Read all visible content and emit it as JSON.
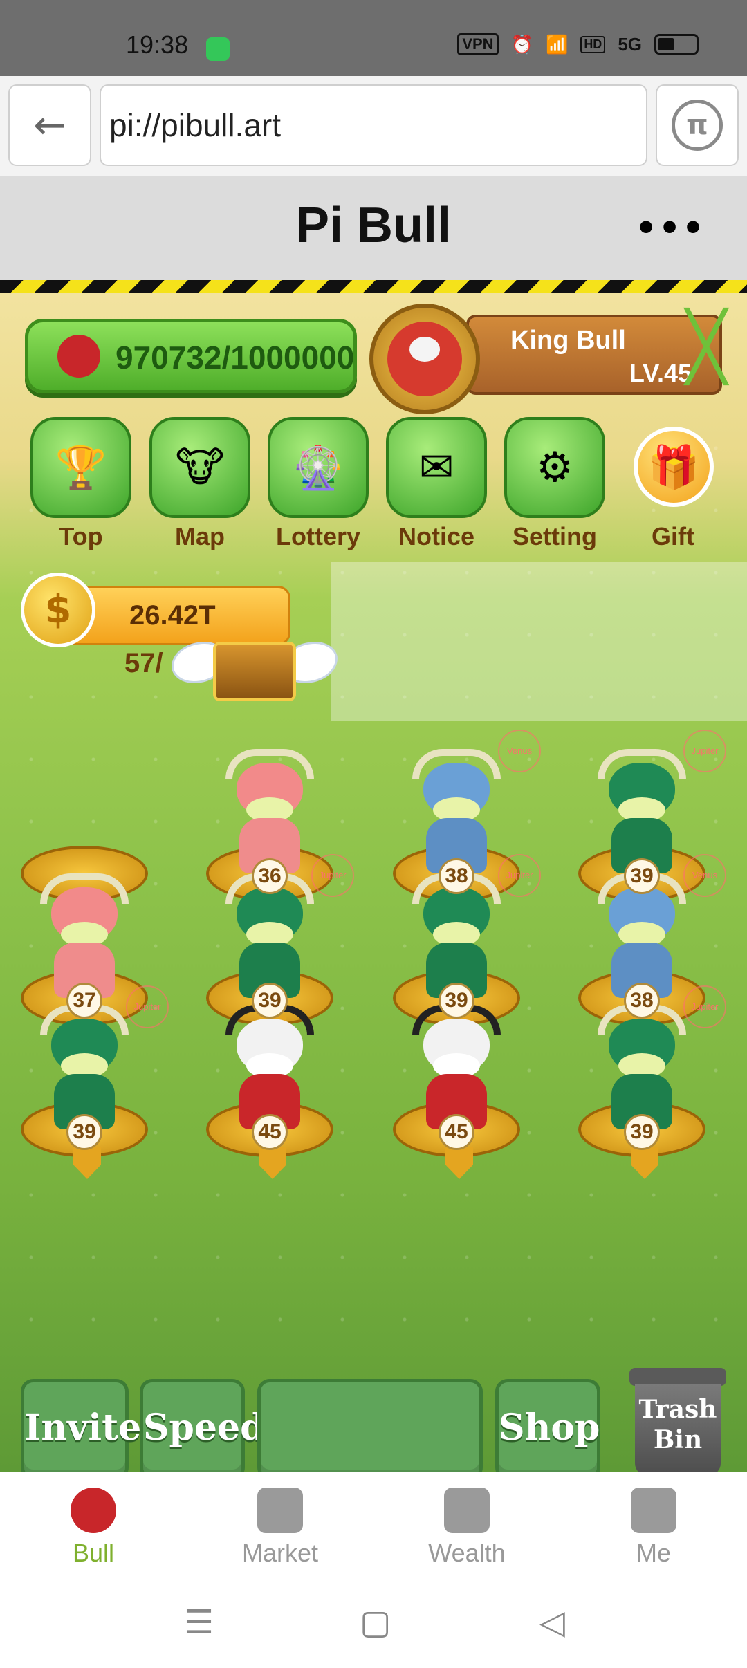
{
  "status_bar": {
    "time": "19:38",
    "vpn": "VPN",
    "hd": "HD",
    "network": "5G"
  },
  "browser": {
    "url": "pi://pibull.art",
    "back_icon": "arrow-left-icon",
    "pi_icon": "pi-logo-icon"
  },
  "page": {
    "title": "Pi Bull",
    "more": "•••"
  },
  "player": {
    "progress": "970732/1000000",
    "name": "King Bull",
    "level": "LV.45"
  },
  "menu": [
    {
      "label": "Top",
      "icon": "ranking-icon"
    },
    {
      "label": "Map",
      "icon": "map-bull-icon"
    },
    {
      "label": "Lottery",
      "icon": "wheel-icon"
    },
    {
      "label": "Notice",
      "icon": "envelope-icon"
    },
    {
      "label": "Setting",
      "icon": "gear-icon"
    },
    {
      "label": "Gift",
      "icon": "gift-icon"
    }
  ],
  "coins": {
    "value": "26.42T",
    "slots": "57/"
  },
  "grid": [
    {
      "level": "",
      "type": "empty",
      "tag": ""
    },
    {
      "level": "36",
      "type": "pink",
      "tag": ""
    },
    {
      "level": "38",
      "type": "blue",
      "tag": "Venus"
    },
    {
      "level": "39",
      "type": "green",
      "tag": "Jupiter"
    },
    {
      "level": "37",
      "type": "pink",
      "tag": ""
    },
    {
      "level": "39",
      "type": "green",
      "tag": "Jupiter"
    },
    {
      "level": "39",
      "type": "green",
      "tag": "Jupiter"
    },
    {
      "level": "38",
      "type": "blue",
      "tag": "Venus"
    },
    {
      "level": "39",
      "type": "green",
      "tag": "Jupiter"
    },
    {
      "level": "45",
      "type": "devil",
      "tag": ""
    },
    {
      "level": "45",
      "type": "devil",
      "tag": ""
    },
    {
      "level": "39",
      "type": "green",
      "tag": "Jupiter"
    }
  ],
  "actions": {
    "invite": "Invite",
    "speed": "Speed",
    "shop": "Shop",
    "trash_line1": "Trash",
    "trash_line2": "Bin"
  },
  "tabs": [
    {
      "label": "Bull",
      "active": true
    },
    {
      "label": "Market",
      "active": false
    },
    {
      "label": "Wealth",
      "active": false
    },
    {
      "label": "Me",
      "active": false
    }
  ],
  "nav": {
    "menu": "☰",
    "home": "▢",
    "back": "◁"
  }
}
